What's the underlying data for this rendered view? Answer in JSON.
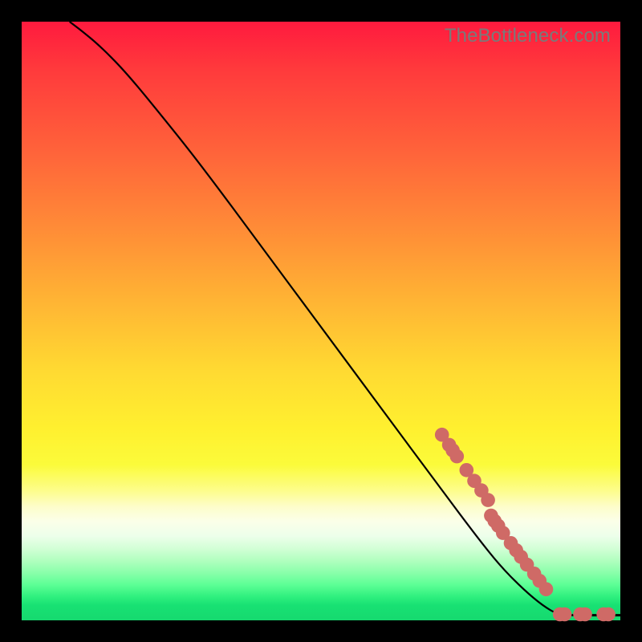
{
  "watermark": "TheBottleneck.com",
  "colors": {
    "dot": "#cf6a66",
    "curve": "#000000",
    "background_black": "#000000"
  },
  "chart_data": {
    "type": "line",
    "title": "",
    "xlabel": "",
    "ylabel": "",
    "xlim": [
      0,
      100
    ],
    "ylim": [
      0,
      100
    ],
    "curve": {
      "description": "Single descending curve from top-left to bottom-right, flattening to a horizontal line near y≈0 after x≈90. Values are fractional (0–100) in plot-area coordinates.",
      "x": [
        8,
        10,
        13,
        17,
        22,
        30,
        40,
        50,
        60,
        70,
        76,
        80,
        84,
        87,
        89.5,
        91,
        100
      ],
      "y": [
        100,
        98.5,
        96,
        92,
        86,
        76,
        62.5,
        49,
        35.5,
        22,
        14,
        9,
        5,
        2.5,
        1,
        0.8,
        0.8
      ]
    },
    "points": {
      "description": "Salmon-colored dots clustered along the lower-right segment of the curve and along the bottom flat line. Coordinates fractional 0–100.",
      "xy": [
        [
          70.2,
          31.0
        ],
        [
          71.4,
          29.3
        ],
        [
          72.0,
          28.4
        ],
        [
          72.7,
          27.4
        ],
        [
          74.3,
          25.1
        ],
        [
          75.6,
          23.3
        ],
        [
          76.8,
          21.7
        ],
        [
          77.9,
          20.1
        ],
        [
          78.4,
          17.5
        ],
        [
          79.0,
          16.6
        ],
        [
          79.6,
          15.8
        ],
        [
          80.4,
          14.6
        ],
        [
          81.7,
          12.9
        ],
        [
          82.6,
          11.7
        ],
        [
          83.4,
          10.6
        ],
        [
          84.4,
          9.3
        ],
        [
          85.6,
          7.8
        ],
        [
          86.5,
          6.6
        ],
        [
          87.6,
          5.2
        ],
        [
          89.9,
          1.0
        ],
        [
          90.7,
          1.0
        ],
        [
          93.3,
          1.0
        ],
        [
          94.1,
          1.0
        ],
        [
          97.2,
          1.0
        ],
        [
          98.0,
          1.0
        ]
      ]
    }
  }
}
